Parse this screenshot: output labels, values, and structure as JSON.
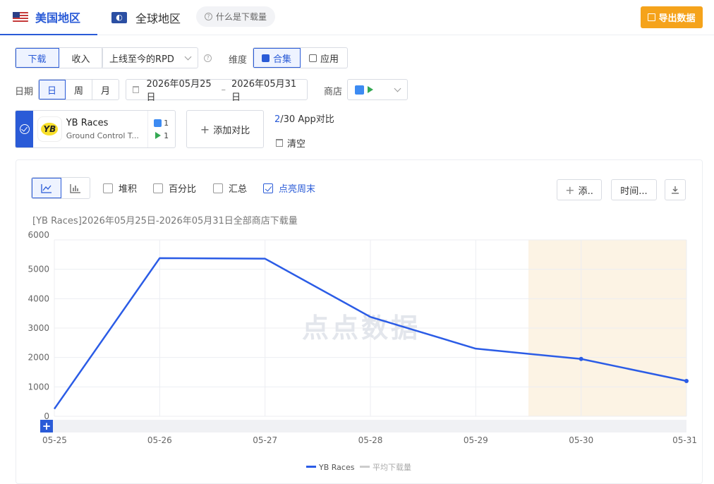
{
  "header": {
    "region_us": "美国地区",
    "region_global": "全球地区",
    "help": "什么是下载量",
    "export": "导出数据"
  },
  "filters": {
    "metric_tabs": [
      "下载",
      "收入"
    ],
    "metric_active": "下载",
    "rpd_select": "上线至今的RPD",
    "dimension_label": "维度",
    "dimension_tabs": [
      "合集",
      "应用"
    ],
    "dimension_active": "合集",
    "date_label": "日期",
    "period_tabs": [
      "日",
      "周",
      "月"
    ],
    "period_active": "日",
    "date_start": "2026年05月25日",
    "date_sep": "–",
    "date_end": "2026年05月31日",
    "store_label": "商店"
  },
  "app_card": {
    "name": "YB Races",
    "developer": "Ground Control T...",
    "appstore_count": "1",
    "googleplay_count": "1",
    "logo_text": "YB"
  },
  "compare": {
    "add_label": "添加对比",
    "count_current": "2",
    "count_rest": "/30 App对比",
    "clear_label": "清空"
  },
  "chart_options": {
    "stacked": "堆积",
    "percent": "百分比",
    "summary": "汇总",
    "highlight_weekend": "点亮周末",
    "add_btn": "添..",
    "time_btn": "时间..."
  },
  "chart_data": {
    "type": "line",
    "title": "[YB Races]2026年05月25日-2026年05月31日全部商店下载量",
    "x": [
      "05-25",
      "05-26",
      "05-27",
      "05-28",
      "05-29",
      "05-30",
      "05-31"
    ],
    "series": [
      {
        "name": "YB Races",
        "values": [
          250,
          5380,
          5360,
          3380,
          2300,
          1950,
          1200
        ],
        "color": "#2b5ce6"
      }
    ],
    "legend": [
      "YB Races",
      "平均下载量"
    ],
    "legend_colors": [
      "#2b5ce6",
      "#cccccc"
    ],
    "ylim": [
      0,
      6000
    ],
    "yticks": [
      0,
      1000,
      2000,
      3000,
      4000,
      5000,
      6000
    ],
    "weekend_highlight": [
      "05-30",
      "05-31"
    ],
    "weekend_color": "#fcf3e4",
    "grid": true,
    "legend_position": "bottom",
    "watermark": "点点数据"
  }
}
